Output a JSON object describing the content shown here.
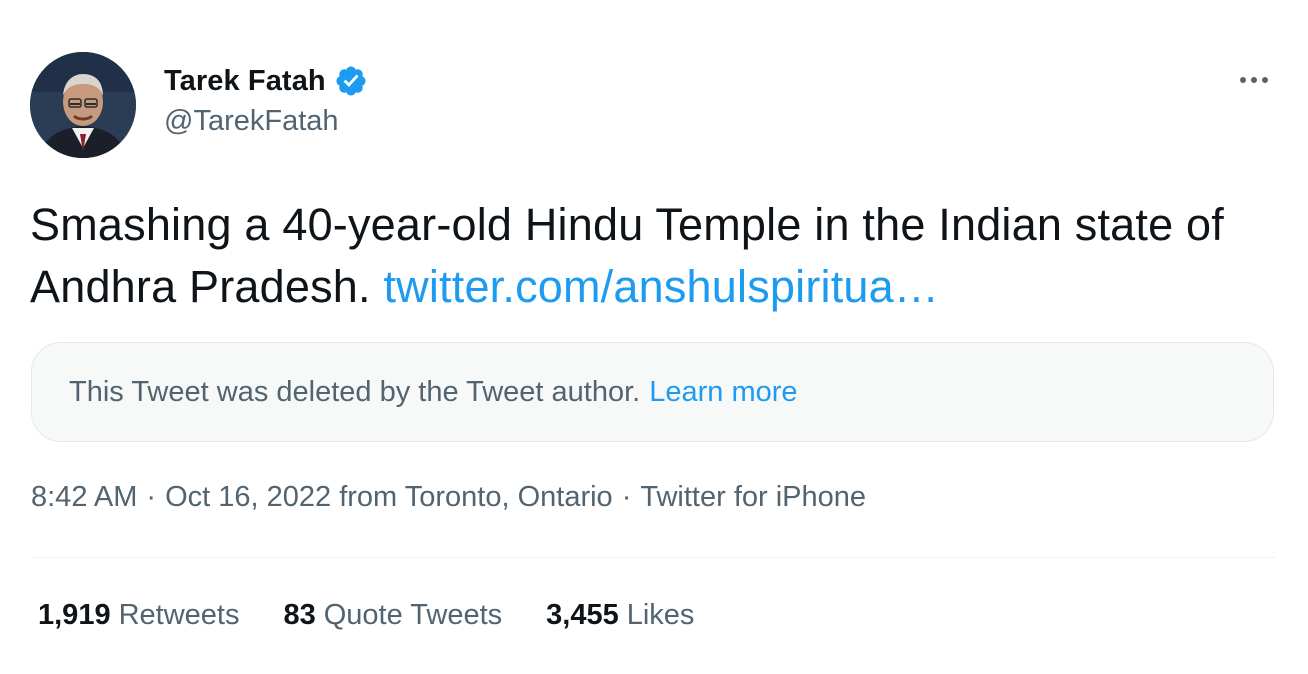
{
  "author": {
    "display_name": "Tarek Fatah",
    "handle": "@TarekFatah",
    "verified": true
  },
  "tweet": {
    "text": "Smashing a 40-year-old Hindu Temple in the Indian state of Andhra Pradesh.",
    "link_text": "twitter.com/anshulspiritua…"
  },
  "quoted": {
    "deleted_message": "This Tweet was deleted by the Tweet author.",
    "learn_more_label": "Learn more"
  },
  "meta": {
    "time": "8:42 AM",
    "date": "Oct 16, 2022",
    "location": "from Toronto, Ontario",
    "separator": "·",
    "source": "Twitter for iPhone"
  },
  "stats": {
    "retweets_count": "1,919",
    "retweets_label": "Retweets",
    "quotes_count": "83",
    "quotes_label": "Quote Tweets",
    "likes_count": "3,455",
    "likes_label": "Likes"
  },
  "colors": {
    "accent": "#1d9bf0",
    "text_primary": "#0f1419",
    "text_secondary": "#536471",
    "card_background": "#f7f9f9"
  },
  "icons": {
    "verified": "verified-badge-icon",
    "more": "more-horizontal-icon"
  }
}
